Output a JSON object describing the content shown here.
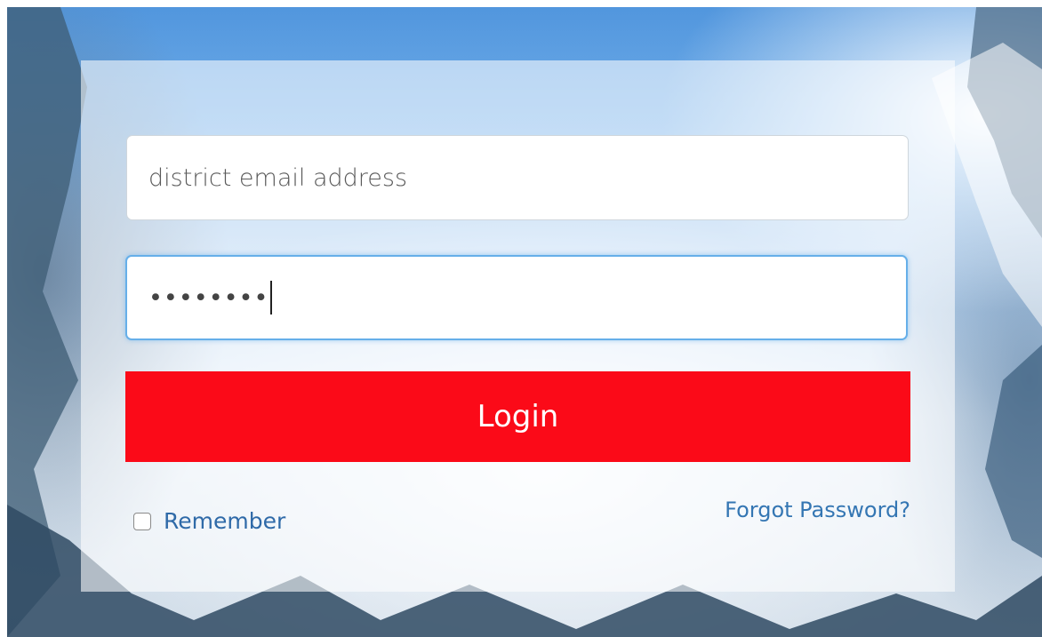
{
  "login_form": {
    "email_placeholder": "district email address",
    "password_value": "••••••••",
    "login_label": "Login",
    "remember_label": "Remember",
    "remember_checked": false,
    "forgot_label": "Forgot Password?"
  },
  "colors": {
    "login_button": "#fb0a18",
    "link": "#3476b3",
    "focus_border": "#66afe9"
  }
}
